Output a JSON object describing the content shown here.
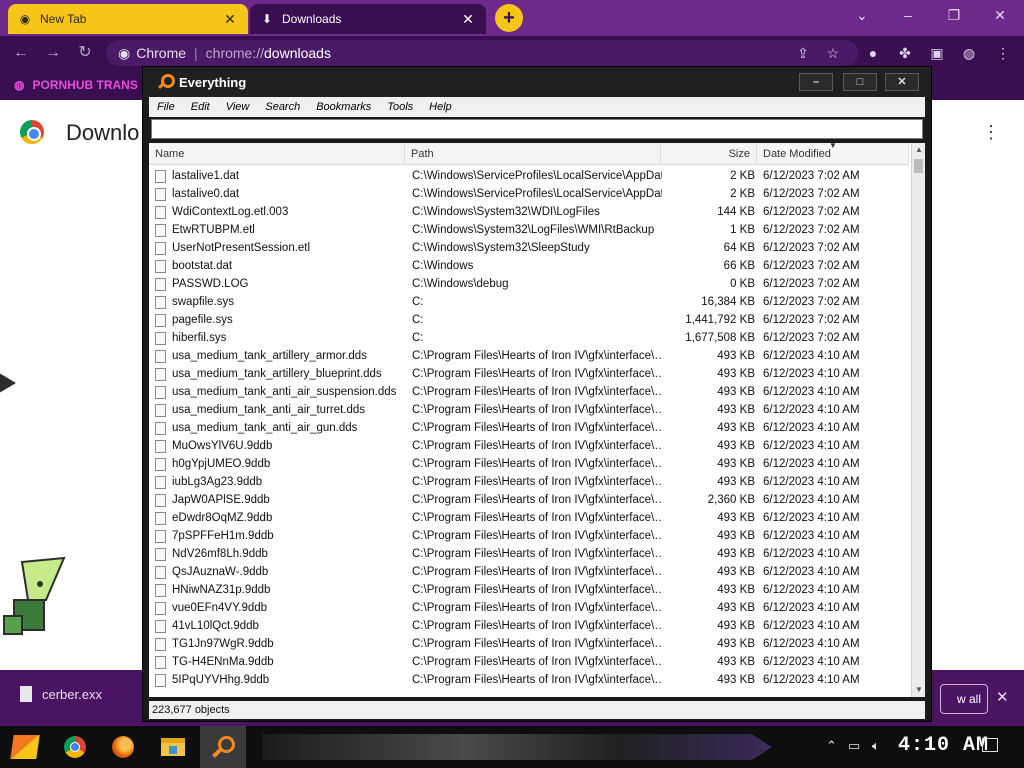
{
  "browser": {
    "tabs": [
      {
        "title": "New Tab",
        "icon": "chrome-icon"
      },
      {
        "title": "Downloads",
        "icon": "download-icon"
      }
    ],
    "new_tab_symbol": "+",
    "omnibox": {
      "chip": "Chrome",
      "url_scheme": "chrome://",
      "url_host": "downloads"
    },
    "bookmark": "PORNHUB TRANS",
    "page_title": "Downlo",
    "shelf": {
      "file_name": "cerber.exx",
      "show_all": "w all"
    }
  },
  "everything": {
    "title": "Everything",
    "controls": {
      "minimize": "–",
      "maximize": "□",
      "close": "✕"
    },
    "menu": [
      "File",
      "Edit",
      "View",
      "Search",
      "Bookmarks",
      "Tools",
      "Help"
    ],
    "search_value": "",
    "columns": {
      "name": "Name",
      "path": "Path",
      "size": "Size",
      "date": "Date Modified"
    },
    "rows": [
      {
        "name": "lastalive1.dat",
        "path": "C:\\Windows\\ServiceProfiles\\LocalService\\AppDat…",
        "size": "2 KB",
        "date": "6/12/2023 7:02 AM"
      },
      {
        "name": "lastalive0.dat",
        "path": "C:\\Windows\\ServiceProfiles\\LocalService\\AppDat…",
        "size": "2 KB",
        "date": "6/12/2023 7:02 AM"
      },
      {
        "name": "WdiContextLog.etl.003",
        "path": "C:\\Windows\\System32\\WDI\\LogFiles",
        "size": "144 KB",
        "date": "6/12/2023 7:02 AM"
      },
      {
        "name": "EtwRTUBPM.etl",
        "path": "C:\\Windows\\System32\\LogFiles\\WMI\\RtBackup",
        "size": "1 KB",
        "date": "6/12/2023 7:02 AM"
      },
      {
        "name": "UserNotPresentSession.etl",
        "path": "C:\\Windows\\System32\\SleepStudy",
        "size": "64 KB",
        "date": "6/12/2023 7:02 AM"
      },
      {
        "name": "bootstat.dat",
        "path": "C:\\Windows",
        "size": "66 KB",
        "date": "6/12/2023 7:02 AM"
      },
      {
        "name": "PASSWD.LOG",
        "path": "C:\\Windows\\debug",
        "size": "0 KB",
        "date": "6/12/2023 7:02 AM"
      },
      {
        "name": "swapfile.sys",
        "path": "C:",
        "size": "16,384 KB",
        "date": "6/12/2023 7:02 AM"
      },
      {
        "name": "pagefile.sys",
        "path": "C:",
        "size": "1,441,792 KB",
        "date": "6/12/2023 7:02 AM"
      },
      {
        "name": "hiberfil.sys",
        "path": "C:",
        "size": "1,677,508 KB",
        "date": "6/12/2023 7:02 AM"
      },
      {
        "name": "usa_medium_tank_artillery_armor.dds",
        "path": "C:\\Program Files\\Hearts of Iron IV\\gfx\\interface\\…",
        "size": "493 KB",
        "date": "6/12/2023 4:10 AM"
      },
      {
        "name": "usa_medium_tank_artillery_blueprint.dds",
        "path": "C:\\Program Files\\Hearts of Iron IV\\gfx\\interface\\…",
        "size": "493 KB",
        "date": "6/12/2023 4:10 AM"
      },
      {
        "name": "usa_medium_tank_anti_air_suspension.dds",
        "path": "C:\\Program Files\\Hearts of Iron IV\\gfx\\interface\\…",
        "size": "493 KB",
        "date": "6/12/2023 4:10 AM"
      },
      {
        "name": "usa_medium_tank_anti_air_turret.dds",
        "path": "C:\\Program Files\\Hearts of Iron IV\\gfx\\interface\\…",
        "size": "493 KB",
        "date": "6/12/2023 4:10 AM"
      },
      {
        "name": "usa_medium_tank_anti_air_gun.dds",
        "path": "C:\\Program Files\\Hearts of Iron IV\\gfx\\interface\\…",
        "size": "493 KB",
        "date": "6/12/2023 4:10 AM"
      },
      {
        "name": "MuOwsYlV6U.9ddb",
        "path": "C:\\Program Files\\Hearts of Iron IV\\gfx\\interface\\…",
        "size": "493 KB",
        "date": "6/12/2023 4:10 AM"
      },
      {
        "name": "h0gYpjUMEO.9ddb",
        "path": "C:\\Program Files\\Hearts of Iron IV\\gfx\\interface\\…",
        "size": "493 KB",
        "date": "6/12/2023 4:10 AM"
      },
      {
        "name": "iubLg3Ag23.9ddb",
        "path": "C:\\Program Files\\Hearts of Iron IV\\gfx\\interface\\…",
        "size": "493 KB",
        "date": "6/12/2023 4:10 AM"
      },
      {
        "name": "JapW0APlSE.9ddb",
        "path": "C:\\Program Files\\Hearts of Iron IV\\gfx\\interface\\…",
        "size": "2,360 KB",
        "date": "6/12/2023 4:10 AM"
      },
      {
        "name": "eDwdr8OqMZ.9ddb",
        "path": "C:\\Program Files\\Hearts of Iron IV\\gfx\\interface\\…",
        "size": "493 KB",
        "date": "6/12/2023 4:10 AM"
      },
      {
        "name": "7pSPFFeH1m.9ddb",
        "path": "C:\\Program Files\\Hearts of Iron IV\\gfx\\interface\\…",
        "size": "493 KB",
        "date": "6/12/2023 4:10 AM"
      },
      {
        "name": "NdV26mf8Lh.9ddb",
        "path": "C:\\Program Files\\Hearts of Iron IV\\gfx\\interface\\…",
        "size": "493 KB",
        "date": "6/12/2023 4:10 AM"
      },
      {
        "name": "QsJAuznaW-.9ddb",
        "path": "C:\\Program Files\\Hearts of Iron IV\\gfx\\interface\\…",
        "size": "493 KB",
        "date": "6/12/2023 4:10 AM"
      },
      {
        "name": "HNiwNAZ31p.9ddb",
        "path": "C:\\Program Files\\Hearts of Iron IV\\gfx\\interface\\…",
        "size": "493 KB",
        "date": "6/12/2023 4:10 AM"
      },
      {
        "name": "vue0EFn4VY.9ddb",
        "path": "C:\\Program Files\\Hearts of Iron IV\\gfx\\interface\\…",
        "size": "493 KB",
        "date": "6/12/2023 4:10 AM"
      },
      {
        "name": "41vL10lQct.9ddb",
        "path": "C:\\Program Files\\Hearts of Iron IV\\gfx\\interface\\…",
        "size": "493 KB",
        "date": "6/12/2023 4:10 AM"
      },
      {
        "name": "TG1Jn97WgR.9ddb",
        "path": "C:\\Program Files\\Hearts of Iron IV\\gfx\\interface\\…",
        "size": "493 KB",
        "date": "6/12/2023 4:10 AM"
      },
      {
        "name": "TG-H4ENnMa.9ddb",
        "path": "C:\\Program Files\\Hearts of Iron IV\\gfx\\interface\\…",
        "size": "493 KB",
        "date": "6/12/2023 4:10 AM"
      },
      {
        "name": "5IPqUYVHhg.9ddb",
        "path": "C:\\Program Files\\Hearts of Iron IV\\gfx\\interface\\…",
        "size": "493 KB",
        "date": "6/12/2023 4:10 AM"
      }
    ],
    "status": "223,677 objects"
  },
  "taskbar": {
    "clock": "4:10 AM",
    "apps": [
      "start-icon",
      "chrome-icon",
      "firefox-icon",
      "file-explorer-icon",
      "everything-icon"
    ]
  },
  "colors": {
    "chrome_frame": "#3a0f52",
    "chrome_tab_active": "#f5c518",
    "everything_orange": "#f08a1c",
    "taskbar": "#0e0e0e"
  }
}
